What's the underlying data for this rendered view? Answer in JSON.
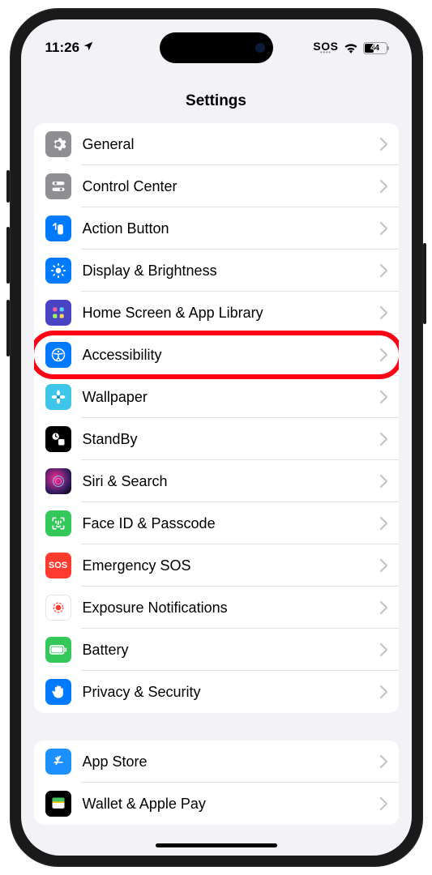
{
  "status": {
    "time": "11:26",
    "sos": "SOS",
    "battery_pct": "44"
  },
  "header": {
    "title": "Settings"
  },
  "group1": {
    "items": [
      {
        "label": "General",
        "icon": "gear-icon"
      },
      {
        "label": "Control Center",
        "icon": "slider-icon"
      },
      {
        "label": "Action Button",
        "icon": "action-icon"
      },
      {
        "label": "Display & Brightness",
        "icon": "brightness-icon"
      },
      {
        "label": "Home Screen & App Library",
        "icon": "grid-icon"
      },
      {
        "label": "Accessibility",
        "icon": "accessibility-icon",
        "highlighted": true
      },
      {
        "label": "Wallpaper",
        "icon": "flower-icon"
      },
      {
        "label": "StandBy",
        "icon": "standby-icon"
      },
      {
        "label": "Siri & Search",
        "icon": "siri-icon"
      },
      {
        "label": "Face ID & Passcode",
        "icon": "faceid-icon"
      },
      {
        "label": "Emergency SOS",
        "icon": "sos-icon"
      },
      {
        "label": "Exposure Notifications",
        "icon": "exposure-icon"
      },
      {
        "label": "Battery",
        "icon": "battery-icon"
      },
      {
        "label": "Privacy & Security",
        "icon": "hand-icon"
      }
    ]
  },
  "group2": {
    "items": [
      {
        "label": "App Store",
        "icon": "appstore-icon"
      },
      {
        "label": "Wallet & Apple Pay",
        "icon": "wallet-icon"
      }
    ]
  },
  "sos_text": "SOS"
}
